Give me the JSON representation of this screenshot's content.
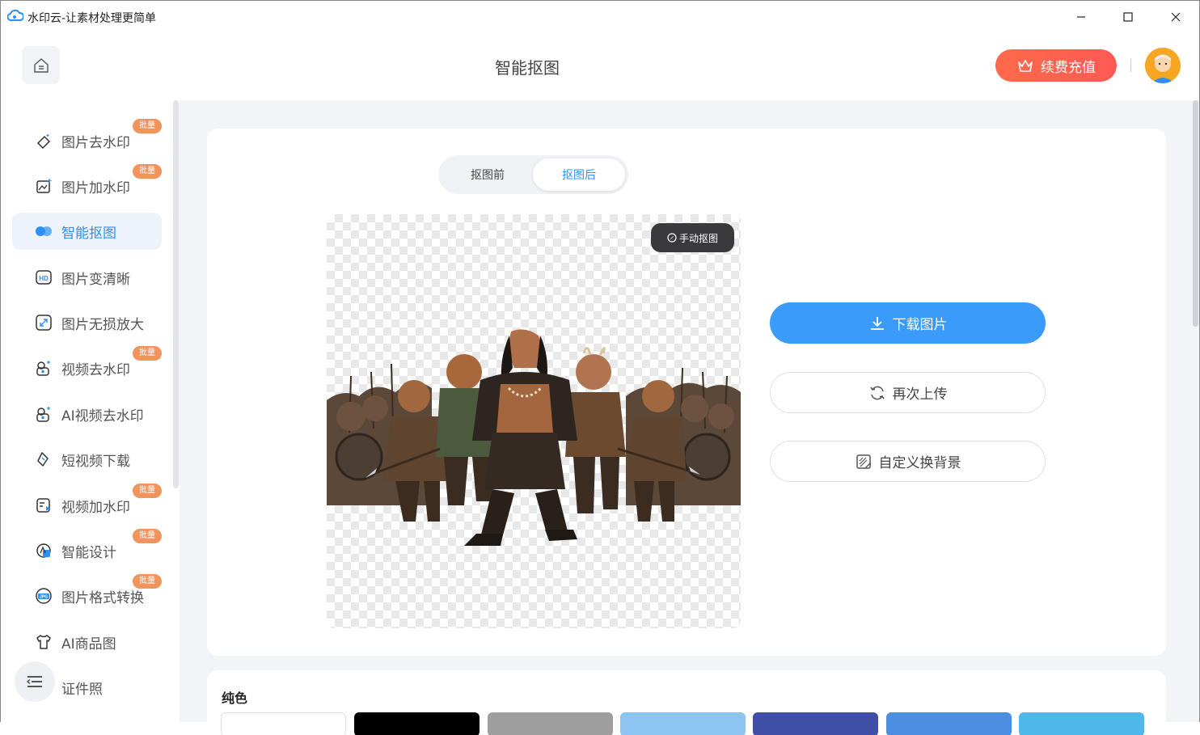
{
  "window": {
    "title": "水印云-让素材处理更简单",
    "controls": [
      "minimize",
      "maximize",
      "close"
    ]
  },
  "header": {
    "title": "智能抠图",
    "vip_button": "续费充值"
  },
  "sidebar": {
    "items": [
      {
        "label": "图片去水印",
        "icon": "eraser-icon",
        "badge": "批量"
      },
      {
        "label": "图片加水印",
        "icon": "image-add-icon",
        "badge": "批量"
      },
      {
        "label": "智能抠图",
        "icon": "cutout-icon",
        "active": true
      },
      {
        "label": "图片变清晰",
        "icon": "hd-icon"
      },
      {
        "label": "图片无损放大",
        "icon": "enlarge-icon"
      },
      {
        "label": "视频去水印",
        "icon": "video-eraser-icon",
        "badge": "批量"
      },
      {
        "label": "AI视频去水印",
        "icon": "ai-video-icon"
      },
      {
        "label": "短视频下载",
        "icon": "link-icon"
      },
      {
        "label": "视频加水印",
        "icon": "video-add-icon",
        "badge": "批量"
      },
      {
        "label": "智能设计",
        "icon": "design-icon",
        "badge": "批量"
      },
      {
        "label": "图片格式转换",
        "icon": "jpg-icon",
        "badge": "批量"
      },
      {
        "label": "AI商品图",
        "icon": "shirt-icon"
      },
      {
        "label": "证件照",
        "icon": "id-photo-icon"
      }
    ]
  },
  "main": {
    "toggle": {
      "before": "抠图前",
      "after": "抠图后",
      "selected": "after"
    },
    "manual_button": "手动抠图",
    "download_button": "下载图片",
    "reupload_button": "再次上传",
    "custom_bg_button": "自定义换背景",
    "background_section": {
      "title": "纯色",
      "colors": [
        "#ffffff",
        "#000000",
        "#9e9e9e",
        "#8cc6f0",
        "#3f4fa8",
        "#4a8fdf",
        "#4fb8ea"
      ]
    }
  },
  "colors": {
    "accent": "#3a9bfa",
    "vip": "#ff5f4f",
    "badge": "#f0935d"
  }
}
